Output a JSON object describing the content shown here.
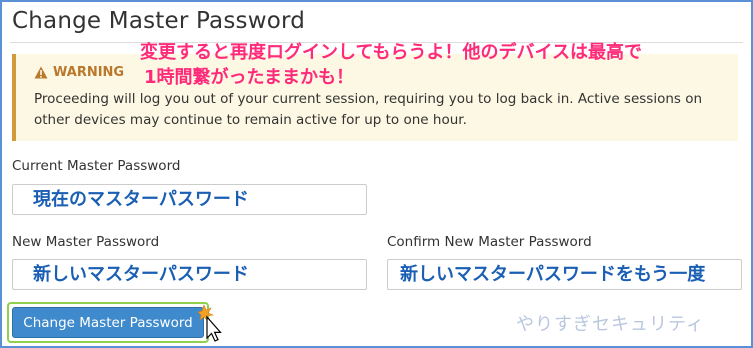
{
  "page": {
    "title": "Change Master Password",
    "annotation_lines": [
      "変更すると再度ログインしてもらうよ！他のデバイスは最高で",
      "1時間繋がったままかも！"
    ],
    "watermark": "やりすぎセキュリティ"
  },
  "warning": {
    "heading": "WARNING",
    "icon": "warning-triangle-icon",
    "text": "Proceeding will log you out of your current session, requiring you to log back in. Active sessions on other devices may continue to remain active for up to one hour."
  },
  "form": {
    "current": {
      "label": "Current Master Password",
      "value": "現在のマスターパスワード"
    },
    "new": {
      "label": "New Master Password",
      "value": "新しいマスターパスワード"
    },
    "confirm": {
      "label": "Confirm New Master Password",
      "value": "新しいマスターパスワードをもう一度"
    },
    "submit_label": "Change Master Password"
  },
  "colors": {
    "accent": "#3e8acc",
    "annotation": "#ff2a7a",
    "warning": "#b9782c",
    "input_text": "#1a5fb4"
  }
}
